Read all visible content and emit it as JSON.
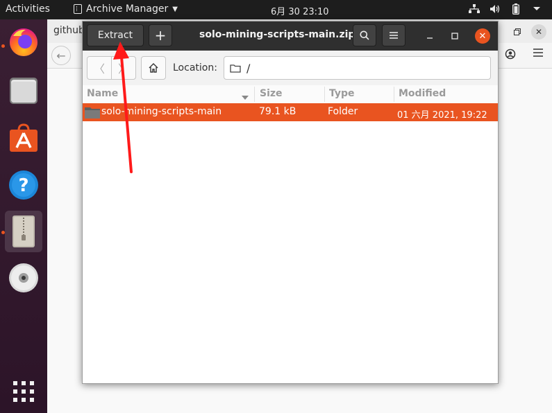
{
  "topbar": {
    "activities": "Activities",
    "app_name": "Archive Manager",
    "clock": "6月 30  23:10"
  },
  "browser": {
    "tab_title": "github"
  },
  "archive": {
    "extract_label": "Extract",
    "add_label": "+",
    "title": "solo-mining-scripts-main.zip",
    "location_label": "Location:",
    "location_value": "/",
    "columns": {
      "name": "Name",
      "size": "Size",
      "type": "Type",
      "modified": "Modified"
    },
    "rows": [
      {
        "name": "solo-mining-scripts-main",
        "size": "79.1 kB",
        "type": "Folder",
        "modified": "01 六月 2021, 19:22"
      }
    ]
  },
  "colors": {
    "accent": "#e95420",
    "headerbar": "#2f2f2f",
    "annotation_arrow": "#ff1a1a"
  }
}
